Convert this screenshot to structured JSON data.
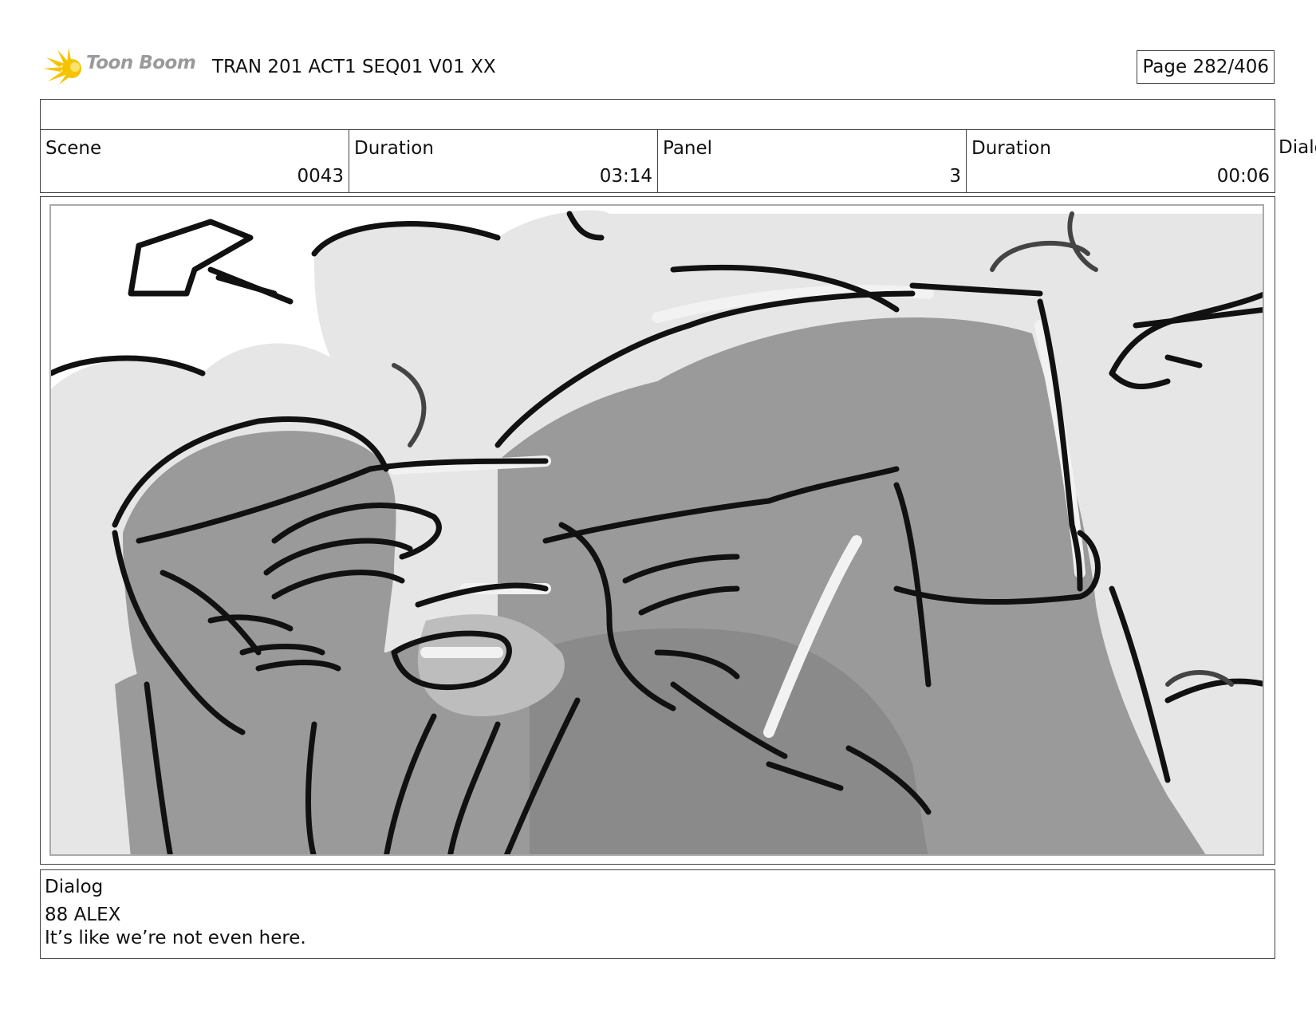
{
  "header": {
    "brand": "Toon Boom",
    "project_title": "TRAN 201 ACT1 SEQ01 V01 XX",
    "page": "Page 282/406"
  },
  "info": {
    "scene_label": "Scene",
    "scene_value": "0043",
    "scene_duration_label": "Duration",
    "scene_duration_value": "03:14",
    "panel_label": "Panel",
    "panel_value": "3",
    "panel_duration_label": "Duration",
    "panel_duration_value": "00:06",
    "overflow_label": "Dialo"
  },
  "panel_image": {
    "icon": "storyboard-sketch",
    "palette": {
      "background": "#e6e6e6",
      "shadow": "#9a9a9a",
      "ink": "#111111",
      "highlight": "#f2f2f2"
    }
  },
  "dialog": {
    "label": "Dialog",
    "character": "88 ALEX",
    "line": "It’s like we’re not even here."
  }
}
